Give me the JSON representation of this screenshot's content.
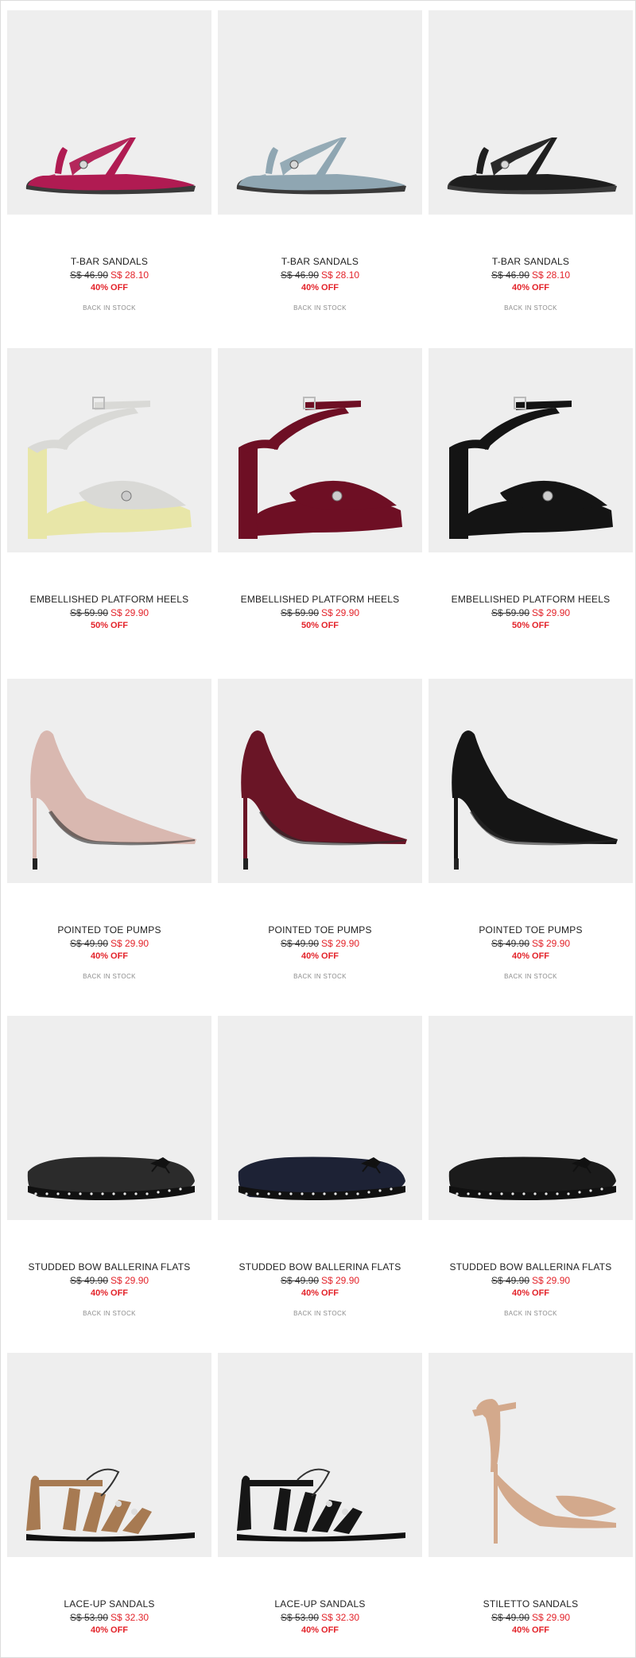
{
  "colors": {
    "accent_red": "#e3232a",
    "image_bg": "#eeeeee",
    "text": "#222222",
    "muted": "#8c8c8c"
  },
  "products": [
    {
      "name": "T-BAR SANDALS",
      "old_price": "S$ 46.90",
      "new_price": "S$ 28.10",
      "discount": "40% OFF",
      "stock": "BACK IN STOCK",
      "shoe_color": "#b01b52",
      "style": "tbar"
    },
    {
      "name": "T-BAR SANDALS",
      "old_price": "S$ 46.90",
      "new_price": "S$ 28.10",
      "discount": "40% OFF",
      "stock": "BACK IN STOCK",
      "shoe_color": "#8fa6b2",
      "style": "tbar"
    },
    {
      "name": "T-BAR SANDALS",
      "old_price": "S$ 46.90",
      "new_price": "S$ 28.10",
      "discount": "40% OFF",
      "stock": "BACK IN STOCK",
      "shoe_color": "#1e1e1e",
      "style": "tbar"
    },
    {
      "name": "EMBELLISHED PLATFORM HEELS",
      "old_price": "S$ 59.90",
      "new_price": "S$ 29.90",
      "discount": "50% OFF",
      "stock": "",
      "shoe_color": "#d9d9d6",
      "heel_color": "#e8e6a8",
      "style": "platform"
    },
    {
      "name": "EMBELLISHED PLATFORM HEELS",
      "old_price": "S$ 59.90",
      "new_price": "S$ 29.90",
      "discount": "50% OFF",
      "stock": "",
      "shoe_color": "#6e0f24",
      "heel_color": "#6e0f24",
      "style": "platform"
    },
    {
      "name": "EMBELLISHED PLATFORM HEELS",
      "old_price": "S$ 59.90",
      "new_price": "S$ 29.90",
      "discount": "50% OFF",
      "stock": "",
      "shoe_color": "#141414",
      "heel_color": "#141414",
      "style": "platform"
    },
    {
      "name": "POINTED TOE PUMPS",
      "old_price": "S$ 49.90",
      "new_price": "S$ 29.90",
      "discount": "40% OFF",
      "stock": "BACK IN STOCK",
      "shoe_color": "#d9b8b0",
      "style": "pump"
    },
    {
      "name": "POINTED TOE PUMPS",
      "old_price": "S$ 49.90",
      "new_price": "S$ 29.90",
      "discount": "40% OFF",
      "stock": "BACK IN STOCK",
      "shoe_color": "#6a1526",
      "style": "pump"
    },
    {
      "name": "POINTED TOE PUMPS",
      "old_price": "S$ 49.90",
      "new_price": "S$ 29.90",
      "discount": "40% OFF",
      "stock": "BACK IN STOCK",
      "shoe_color": "#151515",
      "style": "pump"
    },
    {
      "name": "STUDDED BOW BALLERINA FLATS",
      "old_price": "S$ 49.90",
      "new_price": "S$ 29.90",
      "discount": "40% OFF",
      "stock": "BACK IN STOCK",
      "shoe_color": "#2b2b2b",
      "style": "flat"
    },
    {
      "name": "STUDDED BOW BALLERINA FLATS",
      "old_price": "S$ 49.90",
      "new_price": "S$ 29.90",
      "discount": "40% OFF",
      "stock": "BACK IN STOCK",
      "shoe_color": "#1d2235",
      "style": "flat"
    },
    {
      "name": "STUDDED BOW BALLERINA FLATS",
      "old_price": "S$ 49.90",
      "new_price": "S$ 29.90",
      "discount": "40% OFF",
      "stock": "BACK IN STOCK",
      "shoe_color": "#1b1b1b",
      "style": "flat"
    },
    {
      "name": "LACE-UP SANDALS",
      "old_price": "S$ 53.90",
      "new_price": "S$ 32.30",
      "discount": "40% OFF",
      "stock": "",
      "shoe_color": "#a77a52",
      "style": "laceup"
    },
    {
      "name": "LACE-UP SANDALS",
      "old_price": "S$ 53.90",
      "new_price": "S$ 32.30",
      "discount": "40% OFF",
      "stock": "",
      "shoe_color": "#161616",
      "style": "laceup"
    },
    {
      "name": "STILETTO SANDALS",
      "old_price": "S$ 49.90",
      "new_price": "S$ 29.90",
      "discount": "40% OFF",
      "stock": "",
      "shoe_color": "#d3a98c",
      "style": "stiletto"
    }
  ]
}
